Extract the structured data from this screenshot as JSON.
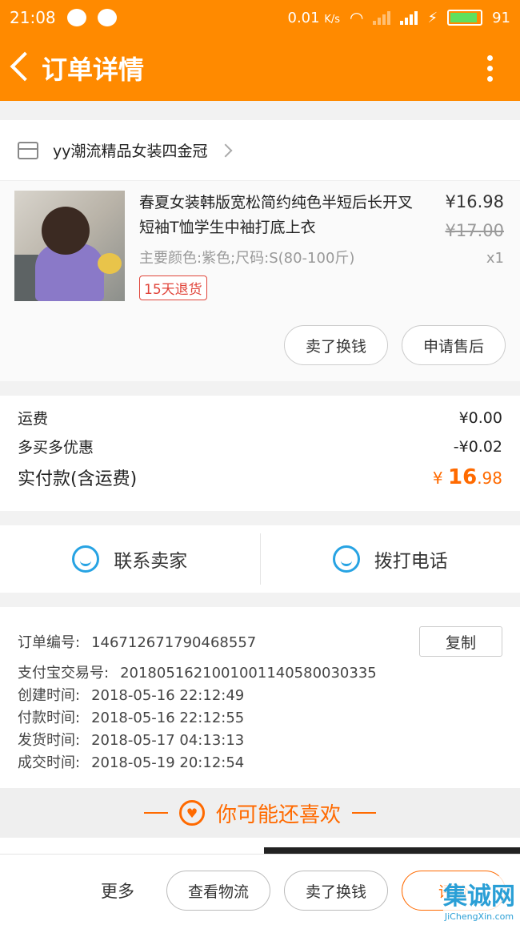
{
  "status": {
    "time": "21:08",
    "speed": "0.01",
    "speed_unit": "K/s",
    "battery": "91",
    "battery_level": 0.91
  },
  "header": {
    "title": "订单详情"
  },
  "shop": {
    "name": "yy潮流精品女装四金冠"
  },
  "product": {
    "title": "春夏女装韩版宽松简约纯色半短后长开叉短袖T恤学生中袖打底上衣",
    "spec": "主要颜色:紫色;尺码:S(80-100斤)",
    "badge": "15天退货",
    "price": "¥16.98",
    "original_price": "¥17.00",
    "qty": "x1",
    "sell_button": "卖了换钱",
    "aftersale_button": "申请售后"
  },
  "costs": {
    "shipping_label": "运费",
    "shipping_value": "¥0.00",
    "discount_label": "多买多优惠",
    "discount_value": "-¥0.02",
    "total_label": "实付款(含运费)",
    "total_symbol": "¥",
    "total_int": "16",
    "total_dec": ".98"
  },
  "contact": {
    "seller": "联系卖家",
    "call": "拨打电话"
  },
  "order_info": {
    "copy_button": "复制",
    "rows": [
      {
        "label": "订单编号:",
        "value": "146712671790468557"
      },
      {
        "label": "支付宝交易号:",
        "value": "2018051621001001140580030335"
      },
      {
        "label": "创建时间:",
        "value": "2018-05-16 22:12:49"
      },
      {
        "label": "付款时间:",
        "value": "2018-05-16 22:12:55"
      },
      {
        "label": "发货时间:",
        "value": "2018-05-17 04:13:13"
      },
      {
        "label": "成交时间:",
        "value": "2018-05-19 20:12:54"
      }
    ]
  },
  "recommend": {
    "title": "你可能还喜欢"
  },
  "footer": {
    "more": "更多",
    "logistics": "查看物流",
    "sell": "卖了换钱",
    "review": "评价"
  },
  "watermark": {
    "big": "集诚网",
    "small": "JiChengXin.com"
  },
  "colors": {
    "accent": "#ff8a00",
    "price": "#ff6a00",
    "icon_blue": "#27a3e3"
  }
}
